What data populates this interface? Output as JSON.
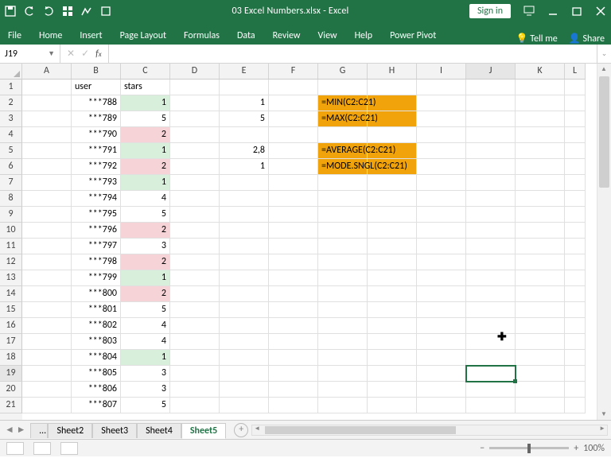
{
  "title": "03 Excel Numbers.xlsx  -  Excel",
  "signin": "Sign in",
  "ribbon": {
    "tabs": [
      "File",
      "Home",
      "Insert",
      "Page Layout",
      "Formulas",
      "Data",
      "Review",
      "View",
      "Help",
      "Power Pivot"
    ],
    "tellme": "Tell me",
    "share": "Share"
  },
  "namebox": "J19",
  "columns": [
    "A",
    "B",
    "C",
    "D",
    "E",
    "F",
    "G",
    "H",
    "I",
    "J",
    "K",
    "L"
  ],
  "row_numbers": [
    1,
    2,
    3,
    4,
    5,
    6,
    7,
    8,
    9,
    10,
    11,
    12,
    13,
    14,
    15,
    16,
    17,
    18,
    19,
    20,
    21
  ],
  "headers": {
    "B1": "user",
    "C1": "stars"
  },
  "users": [
    "***788",
    "***789",
    "***790",
    "***791",
    "***792",
    "***793",
    "***794",
    "***795",
    "***796",
    "***797",
    "***798",
    "***799",
    "***800",
    "***801",
    "***802",
    "***803",
    "***804",
    "***805",
    "***806",
    "***807"
  ],
  "stars": [
    1,
    5,
    2,
    1,
    2,
    1,
    4,
    5,
    2,
    3,
    2,
    1,
    2,
    5,
    4,
    4,
    1,
    3,
    3,
    5
  ],
  "star_color": [
    "green",
    "",
    "pink",
    "green",
    "pink",
    "green",
    "",
    "",
    "pink",
    "",
    "pink",
    "green",
    "pink",
    "",
    "",
    "",
    "green",
    "",
    "",
    ""
  ],
  "E": {
    "r2": "1",
    "r3": "5",
    "r5": "2,8",
    "r6": "1"
  },
  "G": {
    "r2": "=MIN(C2:C21)",
    "r3": "=MAX(C2:C21)",
    "r5": "=AVERAGE(C2:C21)",
    "r6": "=MODE.SNGL(C2:C21)"
  },
  "sheets": {
    "ellipsis": "…",
    "list": [
      "Sheet2",
      "Sheet3",
      "Sheet4",
      "Sheet5"
    ],
    "active": "Sheet5"
  },
  "zoom_label": "100%",
  "chart_data": {
    "type": "table",
    "columns": [
      "user",
      "stars"
    ],
    "rows": [
      [
        "***788",
        1
      ],
      [
        "***789",
        5
      ],
      [
        "***790",
        2
      ],
      [
        "***791",
        1
      ],
      [
        "***792",
        2
      ],
      [
        "***793",
        1
      ],
      [
        "***794",
        4
      ],
      [
        "***795",
        5
      ],
      [
        "***796",
        2
      ],
      [
        "***797",
        3
      ],
      [
        "***798",
        2
      ],
      [
        "***799",
        1
      ],
      [
        "***800",
        2
      ],
      [
        "***801",
        5
      ],
      [
        "***802",
        4
      ],
      [
        "***803",
        4
      ],
      [
        "***804",
        1
      ],
      [
        "***805",
        3
      ],
      [
        "***806",
        3
      ],
      [
        "***807",
        5
      ]
    ],
    "stats": {
      "min": 1,
      "max": 5,
      "average": "2,8",
      "mode": 1
    },
    "formulas": [
      "=MIN(C2:C21)",
      "=MAX(C2:C21)",
      "=AVERAGE(C2:C21)",
      "=MODE.SNGL(C2:C21)"
    ]
  }
}
